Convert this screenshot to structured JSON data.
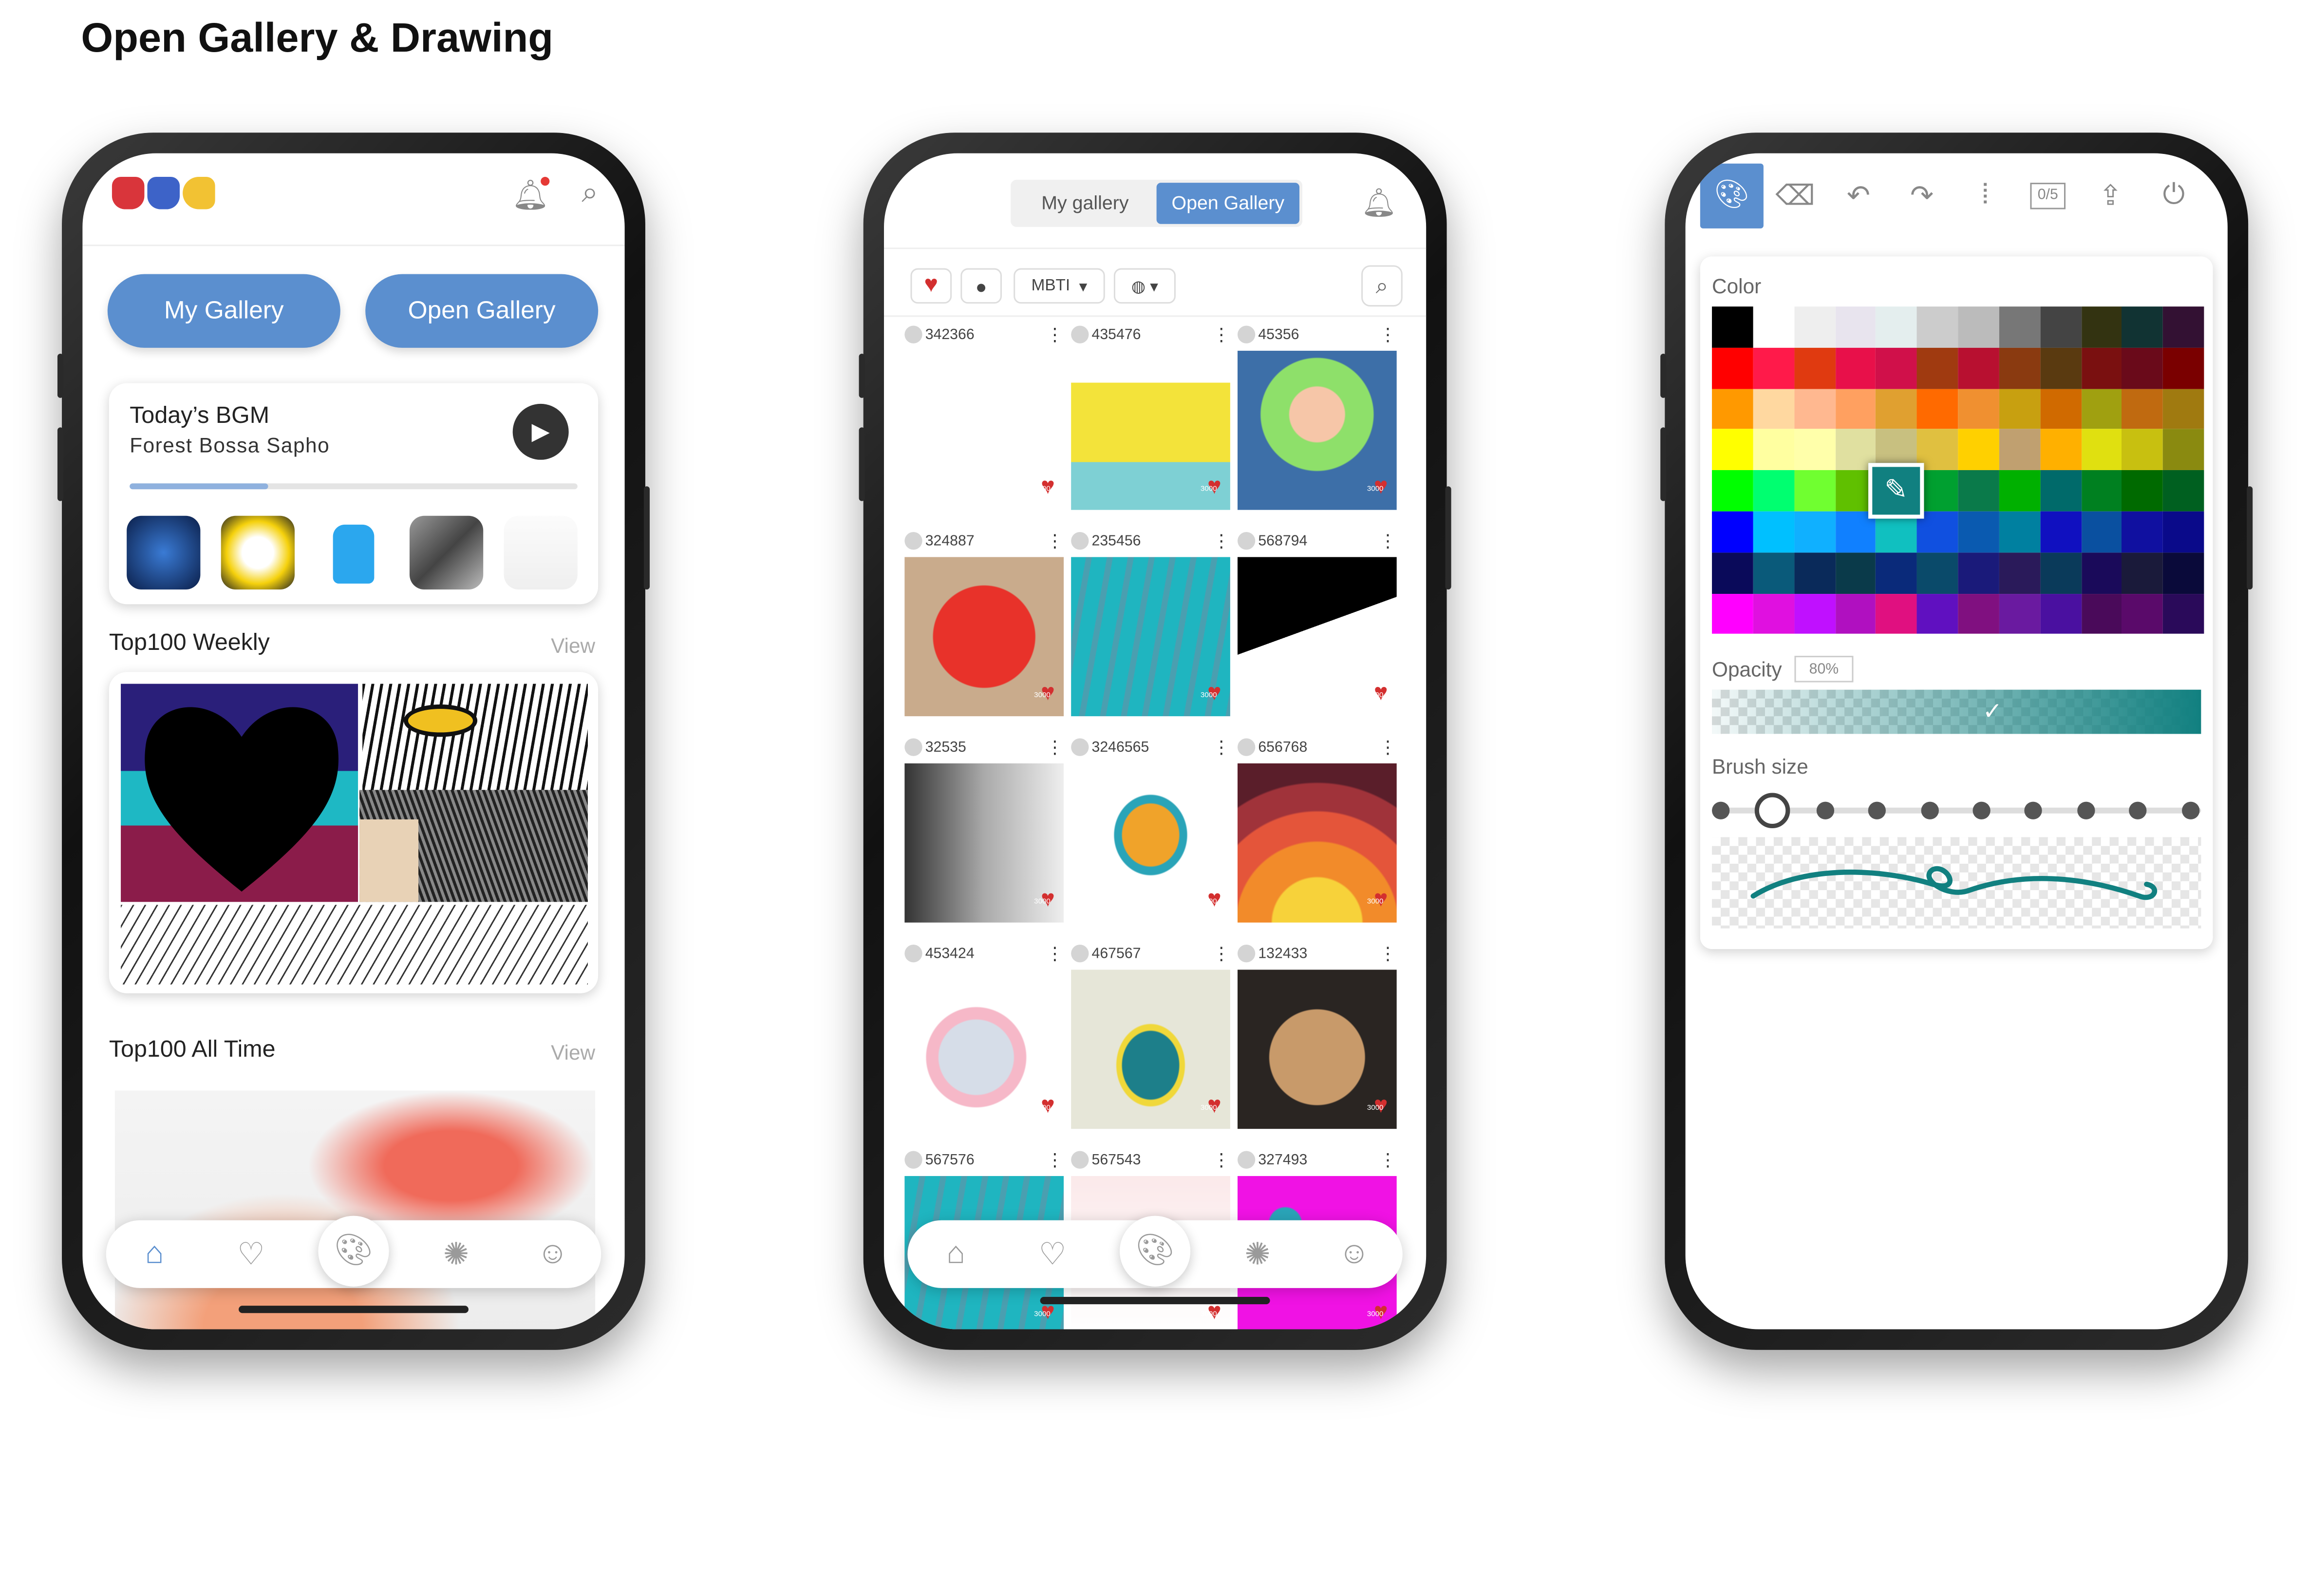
{
  "page_title": "Open Gallery & Drawing",
  "phone1": {
    "my_gallery_button": "My Gallery",
    "open_gallery_button": "Open Gallery",
    "bgm": {
      "title": "Today’s BGM",
      "track": "Forest Bossa Sapho",
      "progress": 0.31
    },
    "weekly": {
      "title": "Top100 Weekly",
      "view": "View"
    },
    "alltime": {
      "title": "Top100 All Time",
      "view": "View"
    },
    "icons": {
      "logo": "mmc-cats-logo",
      "bell": "bell-icon",
      "search": "search-icon",
      "play": "play-icon"
    }
  },
  "phone2": {
    "tabs": [
      "My gallery",
      "Open Gallery"
    ],
    "active_tab": "Open Gallery",
    "filter_mbti": "MBTI",
    "cells": [
      {
        "id": "342366"
      },
      {
        "id": "435476"
      },
      {
        "id": "45356"
      },
      {
        "id": "324887"
      },
      {
        "id": "235456"
      },
      {
        "id": "568794"
      },
      {
        "id": "32535"
      },
      {
        "id": "3246565"
      },
      {
        "id": "656768"
      },
      {
        "id": "453424"
      },
      {
        "id": "467567"
      },
      {
        "id": "132433"
      },
      {
        "id": "567576"
      },
      {
        "id": "567543"
      },
      {
        "id": "327493"
      }
    ],
    "heart_count": "3000"
  },
  "phone3": {
    "labels": {
      "color": "Color",
      "opacity": "Opacity",
      "brush": "Brush size"
    },
    "opacity_value": "80%",
    "layer_badge": "0/5",
    "selected_brush_index": 1,
    "accent_color": "#118080"
  }
}
